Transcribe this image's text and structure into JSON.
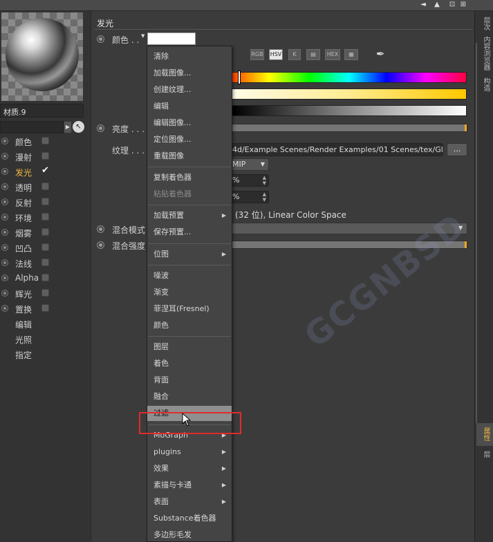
{
  "top_icons": [
    "◄",
    "▲",
    "⊡",
    "⊞"
  ],
  "left": {
    "material_name": "材质.9",
    "channels": [
      {
        "label": "颜色",
        "checked": false,
        "active": false
      },
      {
        "label": "漫射",
        "checked": false,
        "active": false
      },
      {
        "label": "发光",
        "checked": true,
        "active": true
      },
      {
        "label": "透明",
        "checked": false,
        "active": false
      },
      {
        "label": "反射",
        "checked": false,
        "active": false
      },
      {
        "label": "环境",
        "checked": false,
        "active": false
      },
      {
        "label": "烟雾",
        "checked": false,
        "active": false
      },
      {
        "label": "凹凸",
        "checked": false,
        "active": false
      },
      {
        "label": "法线",
        "checked": false,
        "active": false
      },
      {
        "label": "Alpha",
        "checked": false,
        "active": false
      },
      {
        "label": "辉光",
        "checked": false,
        "active": false
      },
      {
        "label": "置换",
        "checked": false,
        "active": false
      }
    ],
    "extra_items": [
      "编辑",
      "光照",
      "指定"
    ],
    "active_color": "#f0b840"
  },
  "main": {
    "section_title": "发光",
    "color_label": "颜色 . .",
    "color_value": "#ffffff",
    "modes": [
      "RGB",
      "HSV",
      "K",
      "▤",
      "HEX",
      "▦"
    ],
    "brightness_label": "亮度 . . . .",
    "texture_label": "纹理 . . . . .",
    "texture_path": "4d/Example Scenes/Render Examples/01 Scenes/tex/Gl",
    "path_more": "...",
    "sampling": "MIP",
    "field1": "%",
    "field2": "%",
    "info": "(32 位), Linear Color Space",
    "blend_mode_label": "混合模式",
    "blend_strength_label": "混合强度"
  },
  "right_tabs": [
    "层次",
    "内容浏览器",
    "构造",
    "属性",
    "层"
  ],
  "menu": {
    "items": [
      {
        "label": "清除",
        "sub": false,
        "disabled": false
      },
      {
        "label": "加载图像...",
        "sub": false,
        "disabled": false
      },
      {
        "label": "创建纹理...",
        "sub": false,
        "disabled": false
      },
      {
        "label": "编辑",
        "sub": false,
        "disabled": false
      },
      {
        "label": "编辑图像...",
        "sub": false,
        "disabled": false
      },
      {
        "label": "定位图像...",
        "sub": false,
        "disabled": false
      },
      {
        "label": "重载图像",
        "sub": false,
        "disabled": false
      },
      {
        "label": "复制着色器",
        "sub": false,
        "disabled": false
      },
      {
        "label": "粘贴着色器",
        "sub": false,
        "disabled": true
      },
      {
        "label": "加载预置",
        "sub": true,
        "disabled": false
      },
      {
        "label": "保存预置...",
        "sub": false,
        "disabled": false
      },
      {
        "label": "位图",
        "sub": true,
        "disabled": false
      },
      {
        "label": "噪波",
        "sub": false,
        "disabled": false
      },
      {
        "label": "渐变",
        "sub": false,
        "disabled": false
      },
      {
        "label": "菲涅耳(Fresnel)",
        "sub": false,
        "disabled": false
      },
      {
        "label": "颜色",
        "sub": false,
        "disabled": false
      },
      {
        "label": "图层",
        "sub": false,
        "disabled": false
      },
      {
        "label": "着色",
        "sub": false,
        "disabled": false
      },
      {
        "label": "背面",
        "sub": false,
        "disabled": false
      },
      {
        "label": "融合",
        "sub": false,
        "disabled": false
      },
      {
        "label": "过滤",
        "sub": false,
        "disabled": false
      },
      {
        "label": "MoGraph",
        "sub": true,
        "disabled": false
      },
      {
        "label": "plugins",
        "sub": true,
        "disabled": false
      },
      {
        "label": "效果",
        "sub": true,
        "disabled": false
      },
      {
        "label": "素描与卡通",
        "sub": true,
        "disabled": false
      },
      {
        "label": "表面",
        "sub": true,
        "disabled": false
      },
      {
        "label": "Substance着色器",
        "sub": false,
        "disabled": false
      },
      {
        "label": "多边形毛发",
        "sub": false,
        "disabled": false
      }
    ],
    "hover_item": "过滤",
    "highlight_color": "#e12b2b"
  },
  "watermark": "GCGNBSD"
}
